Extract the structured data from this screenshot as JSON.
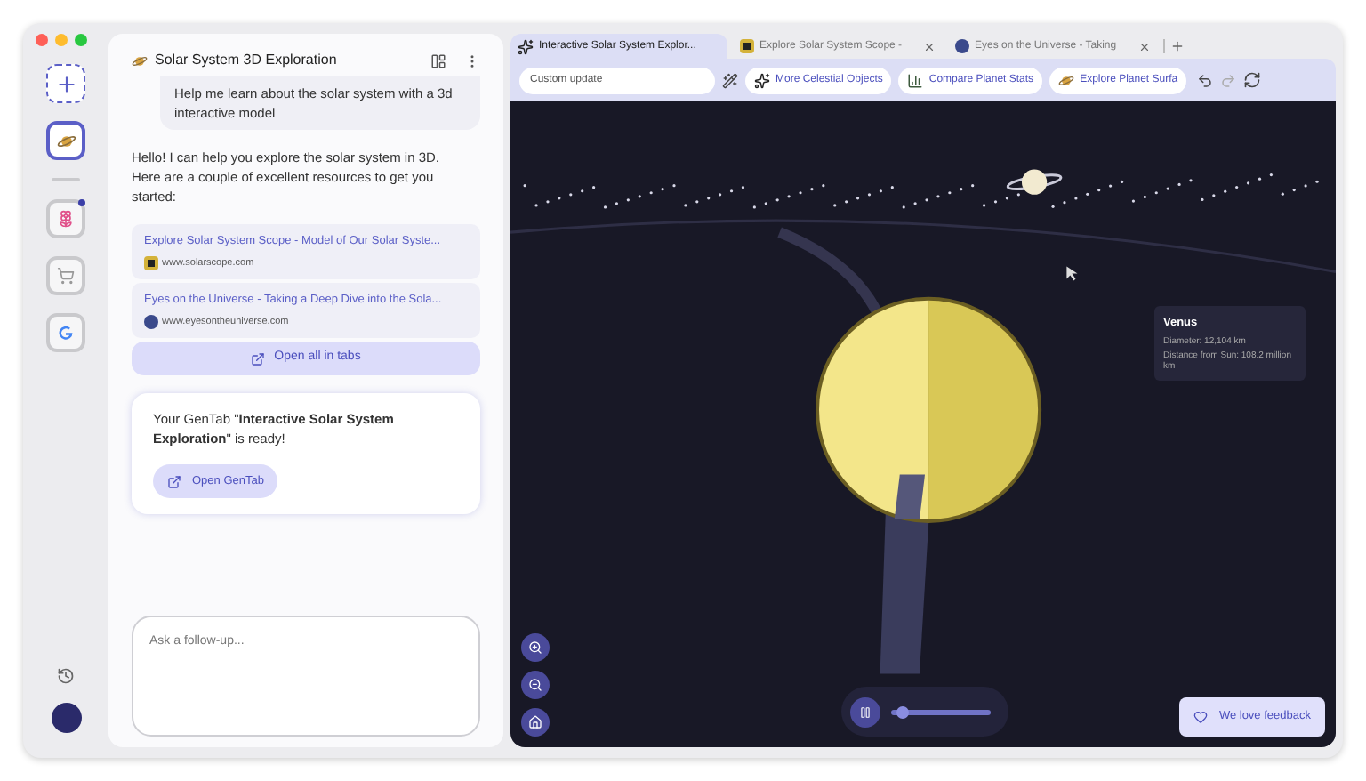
{
  "rail": {
    "items": [
      {
        "kind": "new",
        "selected": false,
        "badge": false
      },
      {
        "kind": "planet",
        "selected": true,
        "badge": false
      },
      {
        "kind": "flower",
        "selected": false,
        "badge": true
      },
      {
        "kind": "cart",
        "selected": false,
        "badge": false
      },
      {
        "kind": "google",
        "selected": false,
        "badge": false
      }
    ]
  },
  "chat": {
    "title": "Solar System 3D Exploration",
    "user_message": "Help me learn about the solar system with a 3d interactive model",
    "reply": "Hello! I can help you explore the solar system in 3D. Here are a couple of excellent resources to get you started:",
    "links": [
      {
        "title": "Explore Solar System Scope - Model of Our Solar Syste...",
        "url": "www.solarscope.com",
        "kind": "square"
      },
      {
        "title": "Eyes on the Universe - Taking a Deep Dive into the Sola...",
        "url": "www.eyesontheuniverse.com",
        "kind": "circle"
      }
    ],
    "open_all": "Open all in tabs",
    "gentab_message": "Your GenTab \"**Interactive Solar System Exploration**\" is ready!",
    "open_gentab": "Open GenTab",
    "input": {
      "placeholder": "Ask a follow-up..."
    }
  },
  "tabs": [
    {
      "label": "Interactive Solar System Explor...",
      "selected": true,
      "kind": "sparkle"
    },
    {
      "label": "Explore Solar System Scope -",
      "selected": false,
      "kind": "square"
    },
    {
      "label": "Eyes on the Universe - Taking",
      "selected": false,
      "kind": "circle"
    }
  ],
  "toolbar": {
    "field": {
      "placeholder": "Custom update"
    },
    "chips": [
      {
        "label": "More Celestial Objects",
        "kind": "sparkle"
      },
      {
        "label": "Compare Planet Stats",
        "kind": "chart"
      },
      {
        "label": "Explore Planet Surfa",
        "kind": "planet"
      }
    ]
  },
  "scene": {
    "tooltip": {
      "title": "Venus",
      "lines": [
        "Diameter: 12,104 km",
        "Distance from Sun: 108.2 million km"
      ]
    },
    "playing": true,
    "speed": {
      "level": 0.12
    },
    "feedback": "We love feedback"
  }
}
